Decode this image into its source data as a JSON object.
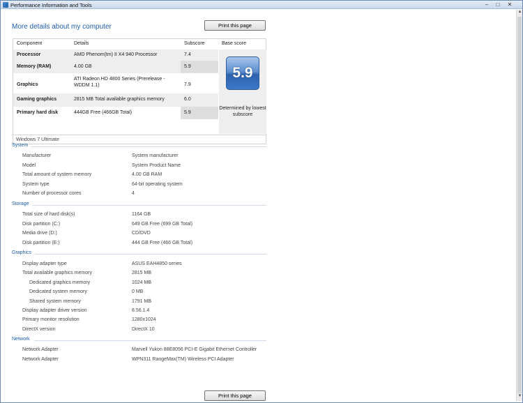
{
  "window": {
    "title": "Performance Information and Tools",
    "minimize_glyph": "–",
    "maximize_glyph": "□",
    "close_glyph": "✕"
  },
  "page": {
    "heading": "More details about my computer",
    "print_label": "Print this page"
  },
  "score_table": {
    "headers": {
      "component": "Component",
      "details": "Details",
      "subscore": "Subscore",
      "base": "Base score"
    },
    "rows": [
      {
        "component": "Processor",
        "details": "AMD Phenom(tm) II X4 940 Processor",
        "subscore": "7.4"
      },
      {
        "component": "Memory (RAM)",
        "details": "4.00 GB",
        "subscore": "5.9"
      },
      {
        "component": "Graphics",
        "details": "ATI Radeon HD 4800 Series (Prerelease - WDDM 1.1)",
        "subscore": "7.9"
      },
      {
        "component": "Gaming graphics",
        "details": "2815 MB Total available graphics memory",
        "subscore": "6.0"
      },
      {
        "component": "Primary hard disk",
        "details": "444GB Free (466GB Total)",
        "subscore": "5.9"
      }
    ],
    "base_score": "5.9",
    "base_caption": "Determined by lowest subscore",
    "edition": "Windows 7 Ultimate"
  },
  "sections": {
    "system": {
      "title": "System",
      "items": [
        {
          "label": "Manufacturer",
          "value": "System manufacturer"
        },
        {
          "label": "Model",
          "value": "System Product Name"
        },
        {
          "label": "Total amount of system memory",
          "value": "4.00 GB RAM"
        },
        {
          "label": "System type",
          "value": "64-bit operating system"
        },
        {
          "label": "Number of processor cores",
          "value": "4"
        }
      ]
    },
    "storage": {
      "title": "Storage",
      "items": [
        {
          "label": "Total size of hard disk(s)",
          "value": "1164 GB"
        },
        {
          "label": "Disk partition (C:)",
          "value": "649 GB Free (699 GB Total)"
        },
        {
          "label": "Media drive (D:)",
          "value": "CD/DVD"
        },
        {
          "label": "Disk partition (E:)",
          "value": "444 GB Free (466 GB Total)"
        }
      ]
    },
    "graphics": {
      "title": "Graphics",
      "items": [
        {
          "label": "Display adapter type",
          "value": "ASUS EAH4850 series"
        },
        {
          "label": "Total available graphics memory",
          "value": "2815 MB"
        },
        {
          "label": "Dedicated graphics memory",
          "value": "1024 MB"
        },
        {
          "label": "Dedicated system memory",
          "value": "0 MB"
        },
        {
          "label": "Shared system memory",
          "value": "1791 MB"
        },
        {
          "label": "Display adapter driver version",
          "value": "8.56.1.4"
        },
        {
          "label": "Primary monitor resolution",
          "value": "1280x1024"
        },
        {
          "label": "DirectX version",
          "value": "DirectX 10"
        }
      ]
    },
    "network": {
      "title": "Network",
      "items": [
        {
          "label": "Network Adapter",
          "value": "Marvell Yukon 88E8056 PCI-E Gigabit Ethernet Controller"
        },
        {
          "label": "Network Adapter",
          "value": "WPN311 RangeMax(TM) Wireless PCI Adapter"
        }
      ]
    }
  }
}
